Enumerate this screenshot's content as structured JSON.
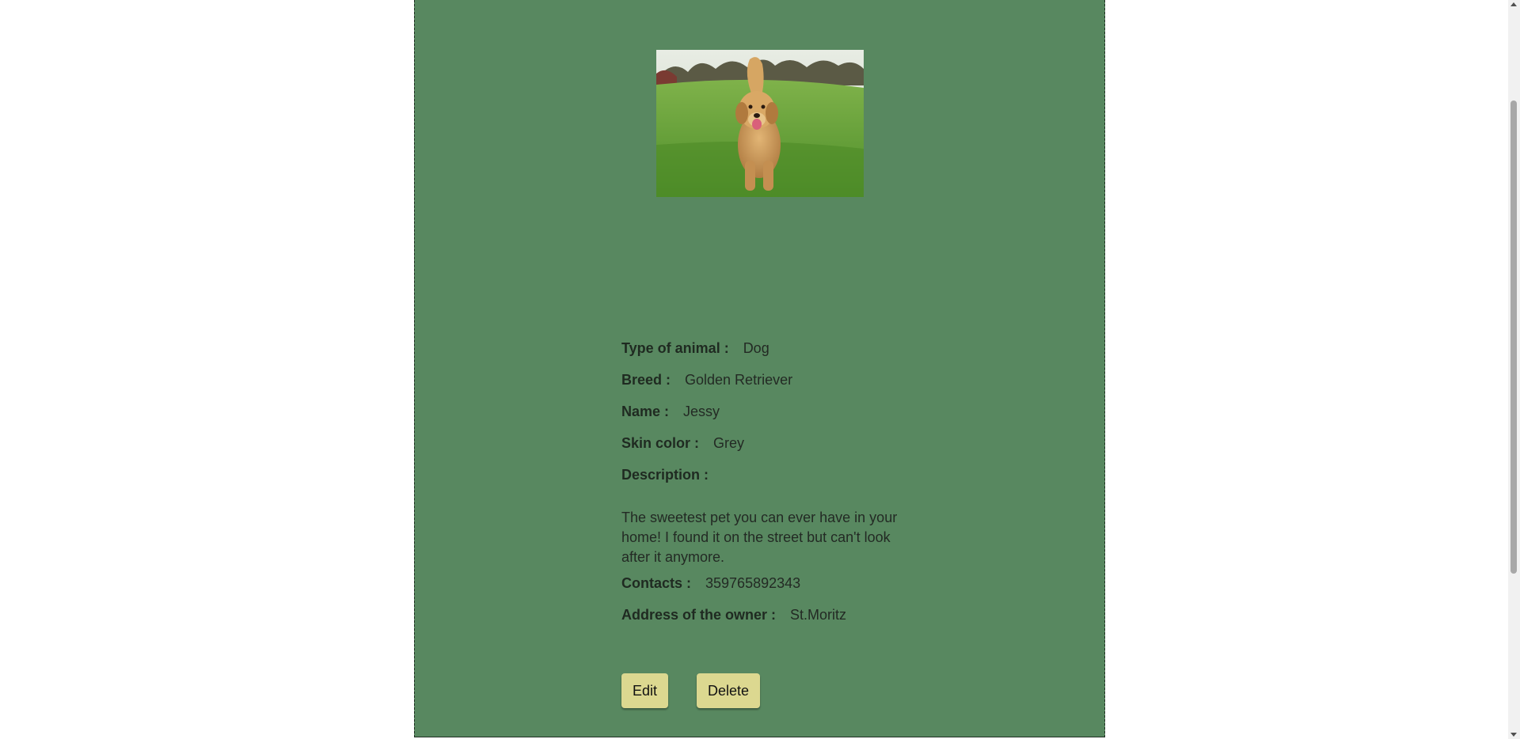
{
  "pet": {
    "photo_alt": "Golden retriever running on grass",
    "fields": [
      {
        "label": "Type of animal :",
        "value": "Dog"
      },
      {
        "label": "Breed :",
        "value": "Golden Retriever"
      },
      {
        "label": "Name :",
        "value": "Jessy"
      },
      {
        "label": "Skin color :",
        "value": "Grey"
      }
    ],
    "description_label": "Description :",
    "description_text": "The sweetest pet you can ever have in your home! I found it on the street but can't look after it anymore.",
    "contacts_label": "Contacts :",
    "contacts_value": "359765892343",
    "address_label": "Address of the owner :",
    "address_value": "St.Moritz"
  },
  "actions": {
    "edit_label": "Edit",
    "delete_label": "Delete"
  },
  "colors": {
    "card_background": "#588860",
    "button_background": "#dcd890"
  }
}
